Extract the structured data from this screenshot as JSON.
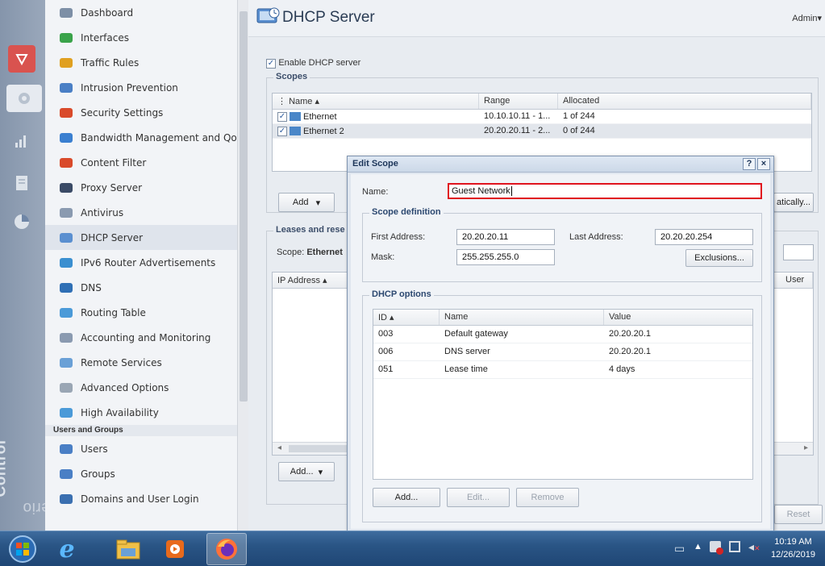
{
  "app": {
    "title": "DHCP Server",
    "user": "Admin"
  },
  "brand": {
    "part1": "Kerio",
    "part2": "Control"
  },
  "nav": {
    "items": [
      {
        "label": "Dashboard",
        "icon": "dashboard-icon"
      },
      {
        "label": "Interfaces",
        "icon": "interfaces-icon"
      },
      {
        "label": "Traffic Rules",
        "icon": "traffic-rules-icon"
      },
      {
        "label": "Intrusion Prevention",
        "icon": "shield-icon"
      },
      {
        "label": "Security Settings",
        "icon": "security-settings-icon"
      },
      {
        "label": "Bandwidth Management and QoS",
        "icon": "bandwidth-icon"
      },
      {
        "label": "Content Filter",
        "icon": "filter-icon"
      },
      {
        "label": "Proxy Server",
        "icon": "proxy-icon"
      },
      {
        "label": "Antivirus",
        "icon": "antivirus-icon"
      },
      {
        "label": "DHCP Server",
        "icon": "dhcp-icon",
        "active": true
      },
      {
        "label": "IPv6 Router Advertisements",
        "icon": "ipv6-icon"
      },
      {
        "label": "DNS",
        "icon": "dns-icon"
      },
      {
        "label": "Routing Table",
        "icon": "routing-icon"
      },
      {
        "label": "Accounting and Monitoring",
        "icon": "accounting-icon"
      },
      {
        "label": "Remote Services",
        "icon": "remote-services-icon"
      },
      {
        "label": "Advanced Options",
        "icon": "advanced-options-icon"
      },
      {
        "label": "High Availability",
        "icon": "high-availability-icon"
      }
    ],
    "section_users": "Users and Groups",
    "users_items": [
      {
        "label": "Users",
        "icon": "users-icon"
      },
      {
        "label": "Groups",
        "icon": "groups-icon"
      },
      {
        "label": "Domains and User Login",
        "icon": "domains-icon"
      }
    ]
  },
  "main": {
    "enable_label": "Enable DHCP server",
    "enable_checked": true,
    "scopes_legend": "Scopes",
    "scopes_columns": [
      "Name",
      "Range",
      "Allocated"
    ],
    "scopes_rows": [
      {
        "name": "Ethernet",
        "range": "10.10.10.11 - 1...",
        "allocated": "1 of 244"
      },
      {
        "name": "Ethernet 2",
        "range": "20.20.20.11 - 2...",
        "allocated": "0 of 244"
      }
    ],
    "add_label": "Add",
    "auto_label": "atically...",
    "leases_legend": "Leases and rese",
    "scope_prefix": "Scope:",
    "scope_value": "Ethernet",
    "leases_col_ip": "IP Address",
    "leases_col_user": "User",
    "add2_label": "Add...",
    "reset_label": "Reset"
  },
  "dialog": {
    "title": "Edit Scope",
    "help": "?",
    "close": "×",
    "name_label": "Name:",
    "name_value": "Guest Network",
    "scope_def_legend": "Scope definition",
    "first_label": "First Address:",
    "first_value": "20.20.20.11",
    "last_label": "Last Address:",
    "last_value": "20.20.20.254",
    "mask_label": "Mask:",
    "mask_value": "255.255.255.0",
    "exclusions_label": "Exclusions...",
    "options_legend": "DHCP options",
    "columns": [
      "ID",
      "Name",
      "Value"
    ],
    "rows": [
      {
        "id": "003",
        "name": "Default gateway",
        "value": "20.20.20.1"
      },
      {
        "id": "006",
        "name": "DNS server",
        "value": "20.20.20.1"
      },
      {
        "id": "051",
        "name": "Lease time",
        "value": "4 days"
      }
    ],
    "add_label": "Add...",
    "edit_label": "Edit...",
    "remove_label": "Remove",
    "highlight_color": "#e0141e"
  },
  "taskbar": {
    "time": "10:19 AM",
    "date": "12/26/2019"
  }
}
